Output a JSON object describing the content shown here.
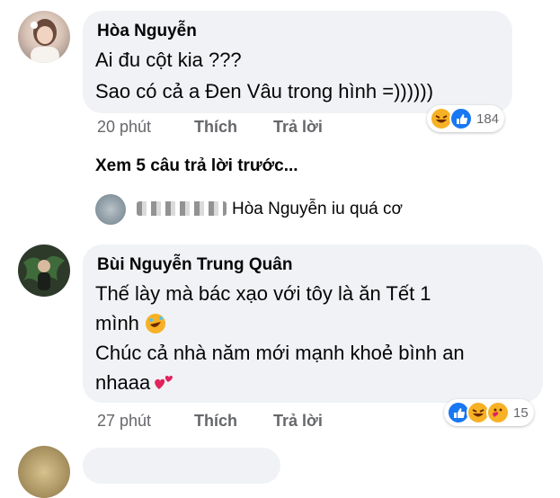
{
  "comments": [
    {
      "author": "Hòa Nguyễn",
      "lines": [
        "Ai đu cột kia ???",
        "Sao có cả a Đen Vâu trong hình =))))))"
      ],
      "time": "20 phút",
      "like": "Thích",
      "reply": "Trả lời",
      "reaction_count": "184"
    },
    {
      "author": "Bùi Nguyễn Trung Quân",
      "lines": [
        "Thế lày mà bác xạo với tôy là ăn Tết 1",
        "mình",
        "Chúc cả nhà năm mới mạnh khoẻ bình an",
        "nhaaa"
      ],
      "time": "27 phút",
      "like": "Thích",
      "reply": "Trả lời",
      "reaction_count": "15"
    }
  ],
  "view_more": "Xem 5 câu trả lời trước...",
  "reply_preview": {
    "text": "Hòa Nguyễn iu quá cơ"
  },
  "colors": {
    "bubble": "#f0f2f5",
    "meta": "#65676b",
    "like_blue": "#1877f2",
    "emoji_yellow": "#f7b125",
    "heart": "#e0245e"
  }
}
